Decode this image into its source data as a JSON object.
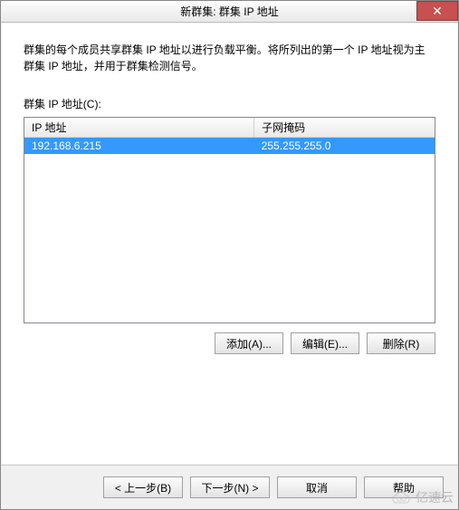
{
  "titlebar": {
    "title": "新群集: 群集 IP 地址",
    "close_label": "✕"
  },
  "description": "群集的每个成员共享群集 IP 地址以进行负载平衡。将所列出的第一个 IP 地址视为主群集 IP 地址，并用于群集检测信号。",
  "list_label": "群集 IP 地址(C):",
  "table": {
    "headers": {
      "ip": "IP 地址",
      "mask": "子网掩码"
    },
    "rows": [
      {
        "ip": "192.168.6.215",
        "mask": "255.255.255.0",
        "selected": true
      }
    ]
  },
  "row_buttons": {
    "add": "添加(A)...",
    "edit": "编辑(E)...",
    "remove": "删除(R)"
  },
  "footer": {
    "back": "< 上一步(B)",
    "next": "下一步(N) >",
    "cancel": "取消",
    "help": "帮助"
  },
  "watermark": "亿速云"
}
